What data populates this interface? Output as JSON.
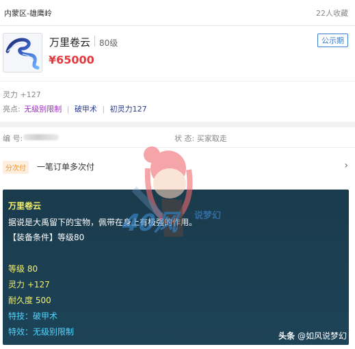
{
  "header": {
    "server": "内蒙区-雄鹰岭",
    "favorites": "22人收藏"
  },
  "item": {
    "name": "万里卷云",
    "level": "80级",
    "price": "¥65000",
    "public_tag": "公示期",
    "icon": "ribbon-item-icon"
  },
  "attributes": {
    "line1": "灵力 +127",
    "highlights_label": "亮点:",
    "highlights": [
      "无级别限制",
      "破甲术",
      "初灵力127"
    ],
    "highlight_colors": [
      "#9a2fbf",
      "#2a3b8f",
      "#2a3b8f"
    ]
  },
  "info": {
    "serial_label": "编  号:",
    "status_label": "状 态: 买家取走"
  },
  "payment": {
    "tag": "分次付",
    "text": "一笔订单多次付",
    "arrow_icon": "chevron-right-icon"
  },
  "tooltip": {
    "title": "万里卷云",
    "description": "据说是大禹留下的宝物，佩带在身上有极强的作用。",
    "requirement": "【装备条件】等级80",
    "stats": [
      "等级 80",
      "灵力 +127",
      "耐久度 500"
    ],
    "effects": [
      "特技：破甲术",
      "特效：无级别限制"
    ]
  },
  "watermark": {
    "text": "40风",
    "subtext": "说梦幻"
  },
  "credit": {
    "brand": "头条",
    "handle": "@如风说梦幻"
  },
  "colors": {
    "price": "#e4393c",
    "tooltip_bg": "#1a3b4c",
    "tooltip_yellow": "#f7f16a",
    "tooltip_cyan": "#51d6ff",
    "accent_blue": "#3d7ecf"
  }
}
